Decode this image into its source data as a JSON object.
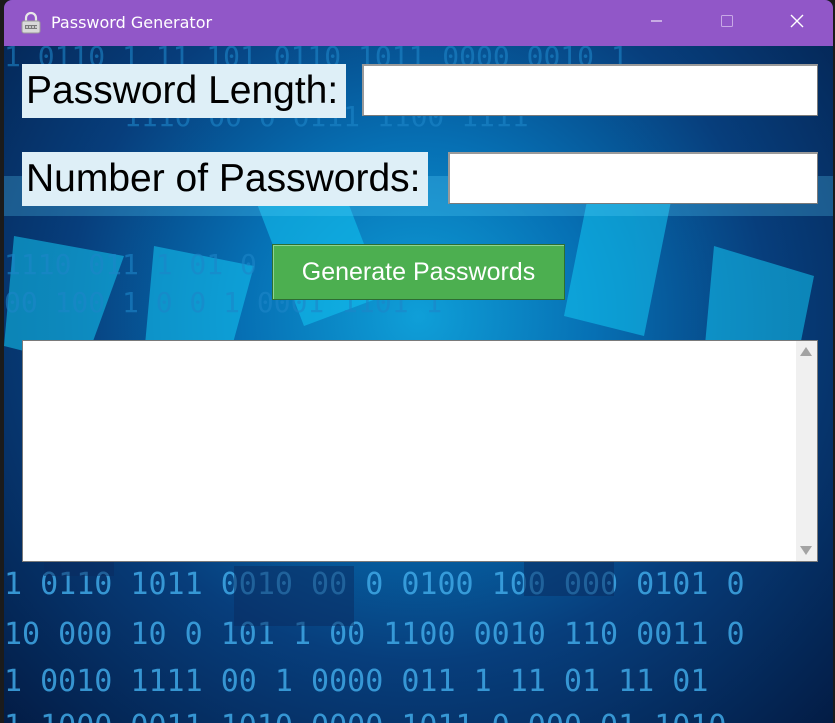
{
  "window": {
    "title": "Password Generator",
    "icons": {
      "app": "lock-icon",
      "minimize": "minimize-icon",
      "maximize": "maximize-icon",
      "close": "close-icon"
    },
    "colors": {
      "titlebar": "#9157c8",
      "button": "#4caf50",
      "label_bg": "#deeff7"
    }
  },
  "form": {
    "length_label": "Password Length:",
    "length_value": "",
    "count_label": "Number of Passwords:",
    "count_value": "",
    "generate_label": "Generate Passwords"
  },
  "output": {
    "value": ""
  }
}
